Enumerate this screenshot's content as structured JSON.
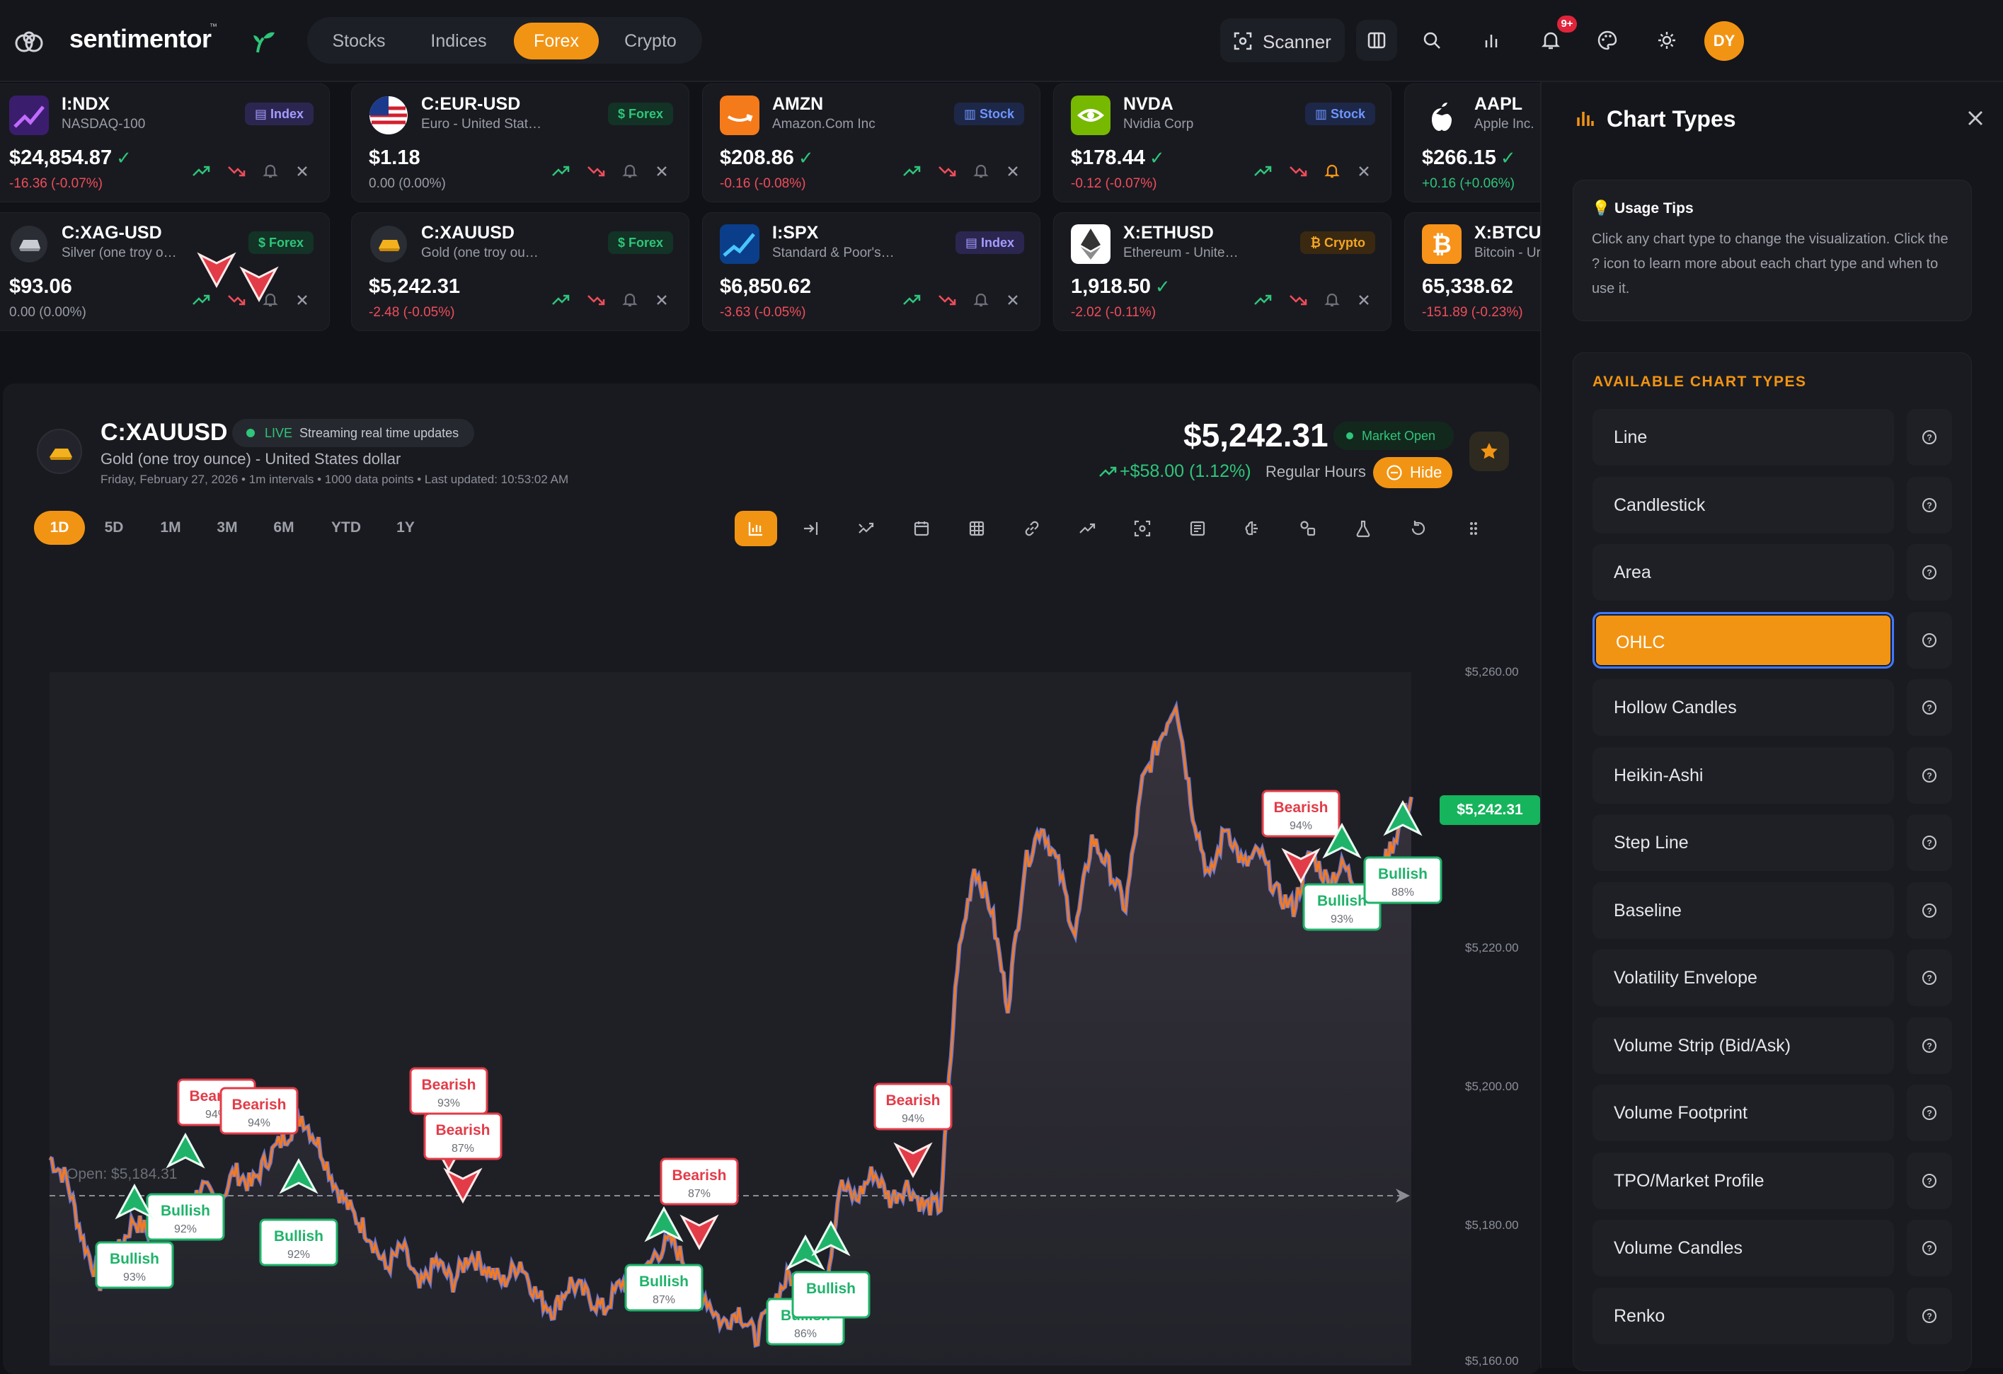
{
  "app": {
    "name": "sentimentor",
    "tm": "™"
  },
  "nav": {
    "tabs": [
      {
        "label": "Stocks"
      },
      {
        "label": "Indices"
      },
      {
        "label": "Forex"
      },
      {
        "label": "Crypto"
      }
    ]
  },
  "header": {
    "scanner_label": "Scanner",
    "notification_badge": "9+",
    "avatar_initials": "DY"
  },
  "tickers": [
    {
      "symbol": "I:NDX",
      "name": "NASDAQ-100",
      "tag": "Index",
      "price": "$24,854.87",
      "change": "-16.36 (-0.07%)",
      "dir": "neg"
    },
    {
      "symbol": "C:EUR-USD",
      "name": "Euro - United Stat…",
      "tag": "Forex",
      "price": "$1.18",
      "change": "0.00 (0.00%)",
      "dir": "neu"
    },
    {
      "symbol": "AMZN",
      "name": "Amazon.Com Inc",
      "tag": "Stock",
      "price": "$208.86",
      "change": "-0.16 (-0.08%)",
      "dir": "neg"
    },
    {
      "symbol": "NVDA",
      "name": "Nvidia Corp",
      "tag": "Stock",
      "price": "$178.44",
      "change": "-0.12 (-0.07%)",
      "dir": "neg"
    },
    {
      "symbol": "AAPL",
      "name": "Apple Inc.",
      "tag": "",
      "price": "$266.15",
      "change": "+0.16 (+0.06%)",
      "dir": "pos"
    },
    {
      "symbol": "C:XAG-USD",
      "name": "Silver (one troy o…",
      "tag": "Forex",
      "price": "$93.06",
      "change": "0.00 (0.00%)",
      "dir": "neu"
    },
    {
      "symbol": "C:XAUUSD",
      "name": "Gold (one troy ou…",
      "tag": "Forex",
      "price": "$5,242.31",
      "change": "-2.48 (-0.05%)",
      "dir": "neg"
    },
    {
      "symbol": "I:SPX",
      "name": "Standard & Poor's…",
      "tag": "Index",
      "price": "$6,850.62",
      "change": "-3.63 (-0.05%)",
      "dir": "neg"
    },
    {
      "symbol": "X:ETHUSD",
      "name": "Ethereum - Unite…",
      "tag": "Crypto",
      "price": "1,918.50",
      "change": "-2.02 (-0.11%)",
      "dir": "neg"
    },
    {
      "symbol": "X:BTCU",
      "name": "Bitcoin - Ur",
      "tag": "",
      "price": "65,338.62",
      "change": "-151.89 (-0.23%)",
      "dir": "neg"
    }
  ],
  "chart_header": {
    "symbol": "C:XAUUSD",
    "live_label": "LIVE",
    "live_text": "Streaming real time updates",
    "name": "Gold (one troy ounce) - United States dollar",
    "meta": "Friday, February 27, 2026 • 1m intervals • 1000 data points • Last updated: 10:53:02 AM",
    "price": "$5,242.31",
    "market_status": "Market Open",
    "change": "+$58.00 (1.12%)",
    "session": "Regular Hours",
    "hide_label": "Hide"
  },
  "ranges": [
    {
      "label": "1D"
    },
    {
      "label": "5D"
    },
    {
      "label": "1M"
    },
    {
      "label": "3M"
    },
    {
      "label": "6M"
    },
    {
      "label": "YTD"
    },
    {
      "label": "1Y"
    }
  ],
  "chart_data": {
    "type": "area",
    "y_ticks": [
      "$5,260.00",
      "$5,220.00",
      "$5,200.00",
      "$5,180.00",
      "$5,160.00"
    ],
    "ylim": [
      5160,
      5260
    ],
    "last_price_label": "$5,242.31",
    "open_label": "Open: $5,184.31",
    "series": [
      {
        "values": [
          5190,
          5187,
          5178,
          5172,
          5176,
          5181,
          5179,
          5184,
          5180,
          5186,
          5183,
          5188,
          5186,
          5190,
          5193,
          5196,
          5192,
          5186,
          5182,
          5179,
          5174,
          5177,
          5171,
          5175,
          5172,
          5176,
          5174,
          5172,
          5175,
          5170,
          5168,
          5172,
          5170,
          5168,
          5172,
          5171,
          5176,
          5178,
          5174,
          5170,
          5166,
          5168,
          5164,
          5169,
          5173,
          5170,
          5168,
          5186,
          5184,
          5188,
          5184,
          5186,
          5183,
          5183,
          5218,
          5232,
          5226,
          5212,
          5232,
          5238,
          5232,
          5222,
          5236,
          5232,
          5226,
          5244,
          5250,
          5256,
          5240,
          5230,
          5238,
          5232,
          5234,
          5228,
          5226,
          5234,
          5230,
          5232,
          5228,
          5230,
          5236,
          5242
        ]
      }
    ],
    "signals": [
      {
        "label": "Bearish",
        "conf": "94%"
      },
      {
        "label": "Bearish",
        "conf": "94%"
      },
      {
        "label": "Bullish",
        "conf": "92%"
      },
      {
        "label": "Bullish",
        "conf": "93%"
      },
      {
        "label": "Bullish",
        "conf": "92%"
      },
      {
        "label": "Bearish",
        "conf": "93%"
      },
      {
        "label": "Bearish",
        "conf": "87%"
      },
      {
        "label": "Bearish",
        "conf": "87%"
      },
      {
        "label": "Bullish",
        "conf": "87%"
      },
      {
        "label": "Bullish",
        "conf": "86%"
      },
      {
        "label": "Bearish",
        "conf": "94%"
      },
      {
        "label": "Bearish",
        "conf": "94%"
      },
      {
        "label": "Bullish",
        "conf": "93%"
      },
      {
        "label": "Bullish",
        "conf": "88%"
      },
      {
        "label": "Bullish",
        "conf": ""
      }
    ]
  },
  "sidebar": {
    "title": "Chart Types",
    "tips_title": "💡 Usage Tips",
    "tips_body": "Click any chart type to change the visualization. Click the ? icon to learn more about each chart type and when to use it.",
    "section_title": "AVAILABLE CHART TYPES",
    "types": [
      {
        "label": "Line"
      },
      {
        "label": "Candlestick"
      },
      {
        "label": "Area"
      },
      {
        "label": "OHLC"
      },
      {
        "label": "Hollow Candles"
      },
      {
        "label": "Heikin-Ashi"
      },
      {
        "label": "Step Line"
      },
      {
        "label": "Baseline"
      },
      {
        "label": "Volatility Envelope"
      },
      {
        "label": "Volume Strip (Bid/Ask)"
      },
      {
        "label": "Volume Footprint"
      },
      {
        "label": "TPO/Market Profile"
      },
      {
        "label": "Volume Candles"
      },
      {
        "label": "Renko"
      }
    ],
    "active_type": "OHLC"
  },
  "colors": {
    "accent": "#f29413",
    "bullish": "#1fb36a",
    "bearish": "#e23c48",
    "price_line_a": "#f47a1f",
    "price_line_b": "#7b8cff"
  }
}
